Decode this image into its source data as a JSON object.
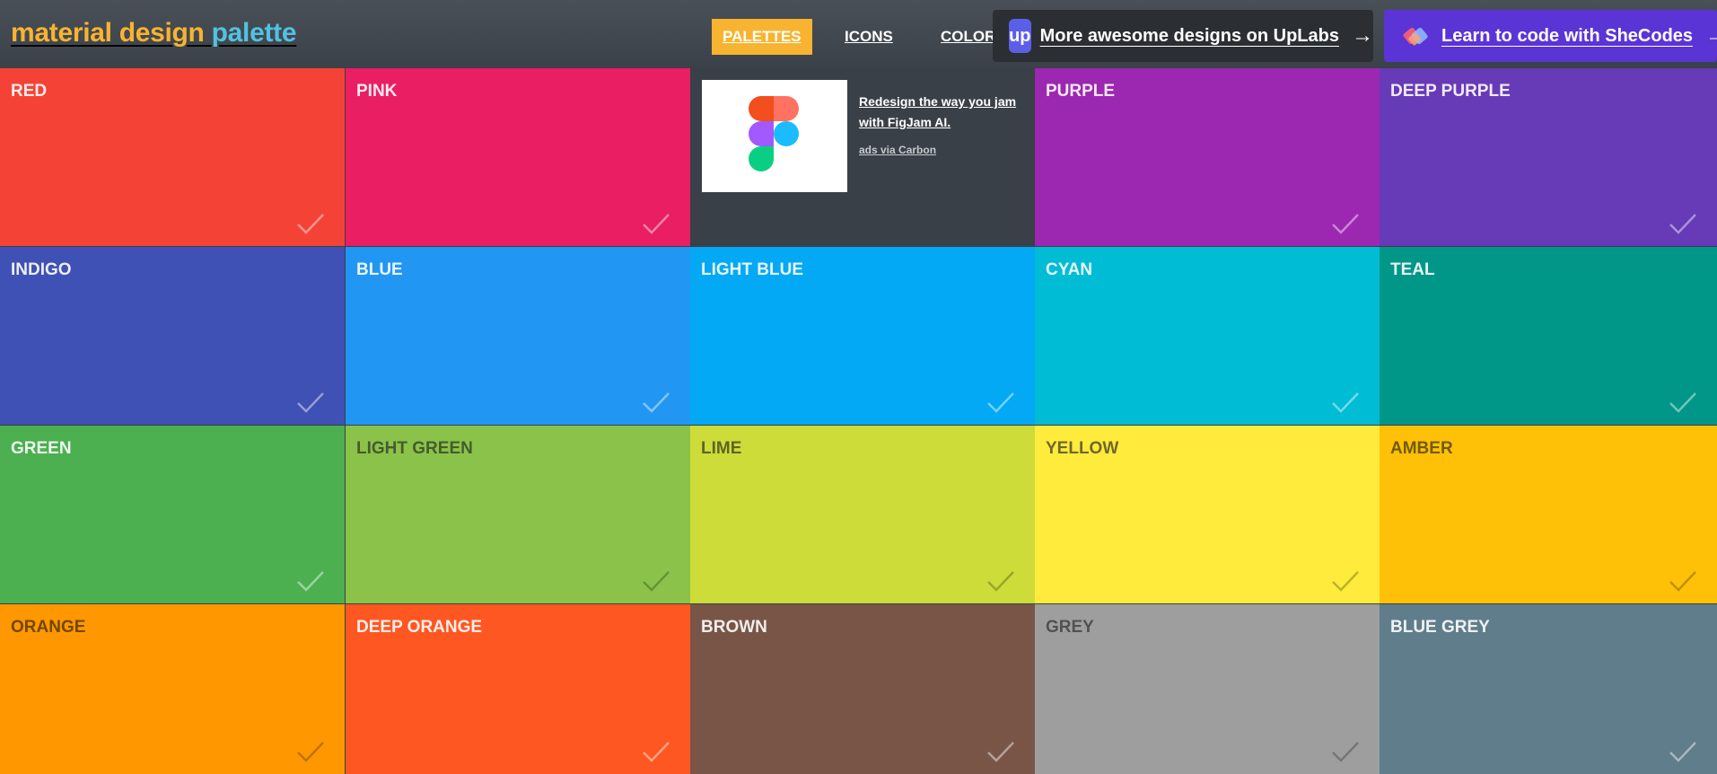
{
  "brand": {
    "word1": "material design",
    "word2": "palette"
  },
  "nav": {
    "palettes": "PALETTES",
    "icons": "ICONS",
    "colors": "COLORS"
  },
  "promos": {
    "uplabs": {
      "logo": "up",
      "label": "More awesome designs on UpLabs",
      "arrow": "→"
    },
    "shecodes": {
      "label": "Learn to code with SheCodes",
      "arrow": "→"
    }
  },
  "ad": {
    "headline": "Redesign the way you jam with FigJam AI.",
    "via": "ads via Carbon",
    "icon": "figma-logo-icon"
  },
  "tiles": [
    {
      "name": "RED",
      "color": "#f44336",
      "text": "#ffffff"
    },
    {
      "name": "PINK",
      "color": "#e91e63",
      "text": "#ffffff"
    },
    {
      "name": "PURPLE",
      "color": "#9c27b0",
      "text": "#ffffff"
    },
    {
      "name": "DEEP PURPLE",
      "color": "#673ab7",
      "text": "#ffffff"
    },
    {
      "name": "INDIGO",
      "color": "#3f51b5",
      "text": "#ffffff"
    },
    {
      "name": "BLUE",
      "color": "#2196f3",
      "text": "#ffffff"
    },
    {
      "name": "LIGHT BLUE",
      "color": "#03a9f4",
      "text": "#ffffff"
    },
    {
      "name": "CYAN",
      "color": "#00bcd4",
      "text": "#ffffff"
    },
    {
      "name": "TEAL",
      "color": "#009688",
      "text": "#ffffff"
    },
    {
      "name": "GREEN",
      "color": "#4caf50",
      "text": "#ffffff"
    },
    {
      "name": "LIGHT GREEN",
      "color": "#8bc34a",
      "text": "#3b4a2a"
    },
    {
      "name": "LIME",
      "color": "#cddc39",
      "text": "#4a5020"
    },
    {
      "name": "YELLOW",
      "color": "#ffeb3b",
      "text": "#55502a"
    },
    {
      "name": "AMBER",
      "color": "#ffc107",
      "text": "#5a4a10"
    },
    {
      "name": "ORANGE",
      "color": "#ff9800",
      "text": "#5a3a00"
    },
    {
      "name": "DEEP ORANGE",
      "color": "#ff5722",
      "text": "#ffffff"
    },
    {
      "name": "BROWN",
      "color": "#795548",
      "text": "#ffffff"
    },
    {
      "name": "GREY",
      "color": "#9e9e9e",
      "text": "#444444"
    },
    {
      "name": "BLUE GREY",
      "color": "#607d8b",
      "text": "#ffffff"
    }
  ],
  "icons": {
    "check": "check-icon",
    "arrow": "arrow-right-icon",
    "shecodes": "shecodes-logo-icon"
  }
}
